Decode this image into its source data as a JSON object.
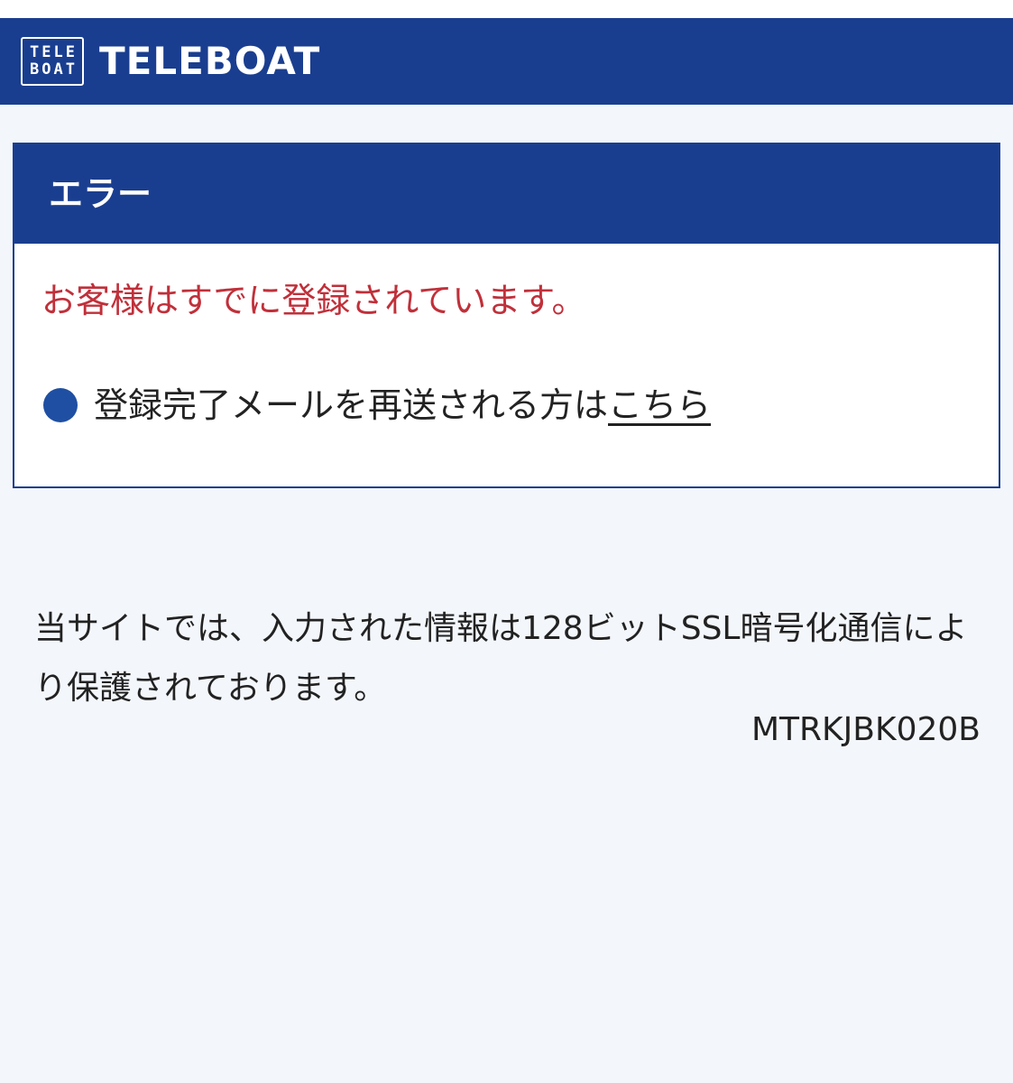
{
  "header": {
    "logo_mark_line1": "TELE",
    "logo_mark_line2": "BOAT",
    "brand_name": "TELEBOAT",
    "background_color": "#1a3e8f"
  },
  "error_panel": {
    "title": "エラー",
    "message": "お客様はすでに登録されています。",
    "message_color": "#c0303a",
    "resend_text": "登録完了メールを再送される方は",
    "resend_link_label": "こちら",
    "bullet_color": "#1f4fa2",
    "bullet_icon": "filled-circle-icon"
  },
  "footer": {
    "ssl_notice": "当サイトでは、入力された情報は128ビットSSL暗号化通信により保護されております。",
    "page_code": "MTRKJBK020B"
  }
}
